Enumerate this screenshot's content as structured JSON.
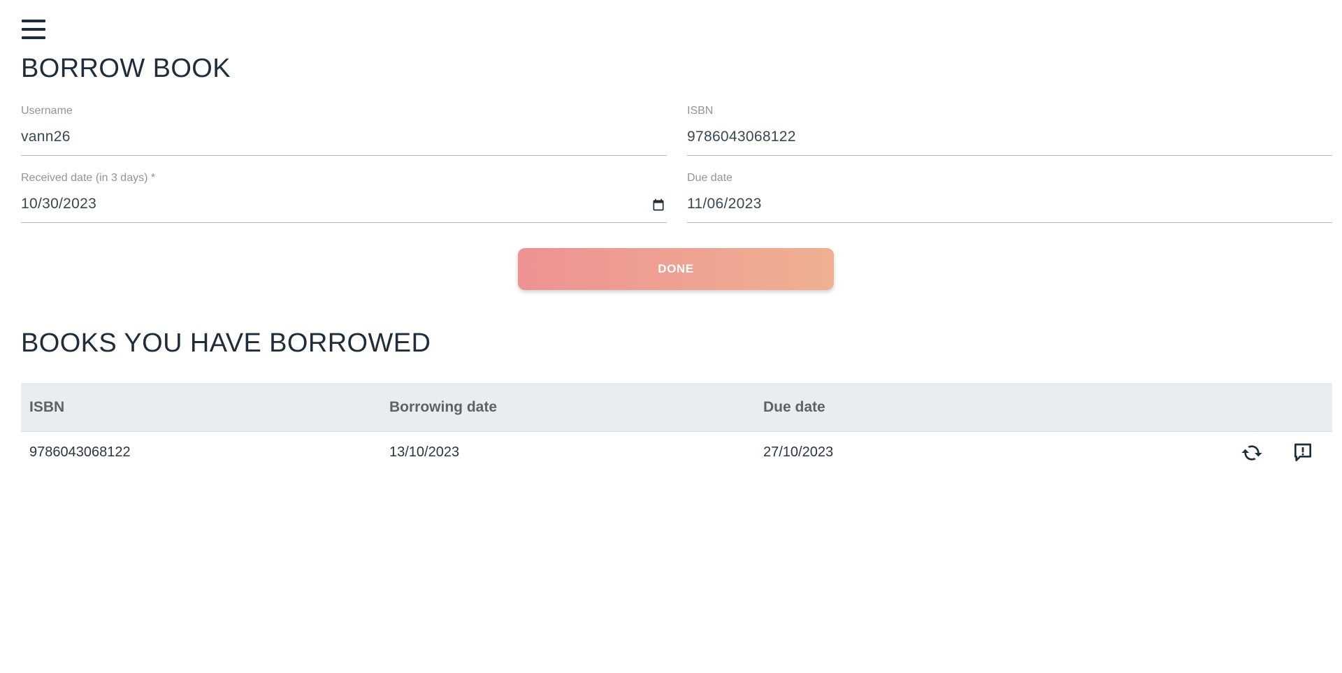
{
  "header": {
    "menu_icon": "hamburger-menu-icon",
    "title": "BORROW BOOK"
  },
  "form": {
    "username": {
      "label": "Username",
      "value": "vann26"
    },
    "isbn": {
      "label": "ISBN",
      "value": "9786043068122"
    },
    "received_date": {
      "label": "Received date (in 3 days) *",
      "value": "10/30/2023",
      "icon": "calendar-icon"
    },
    "due_date": {
      "label": "Due date",
      "value": "11/06/2023"
    },
    "done_label": "DONE",
    "done_gradient": [
      "#ee9293",
      "#efb091"
    ]
  },
  "borrowed": {
    "title": "BOOKS YOU HAVE BORROWED",
    "columns": [
      "ISBN",
      "Borrowing date",
      "Due date"
    ],
    "rows": [
      {
        "isbn": "9786043068122",
        "borrowing_date": "13/10/2023",
        "due_date": "27/10/2023",
        "actions": [
          "renew-icon",
          "report-icon"
        ]
      }
    ]
  }
}
